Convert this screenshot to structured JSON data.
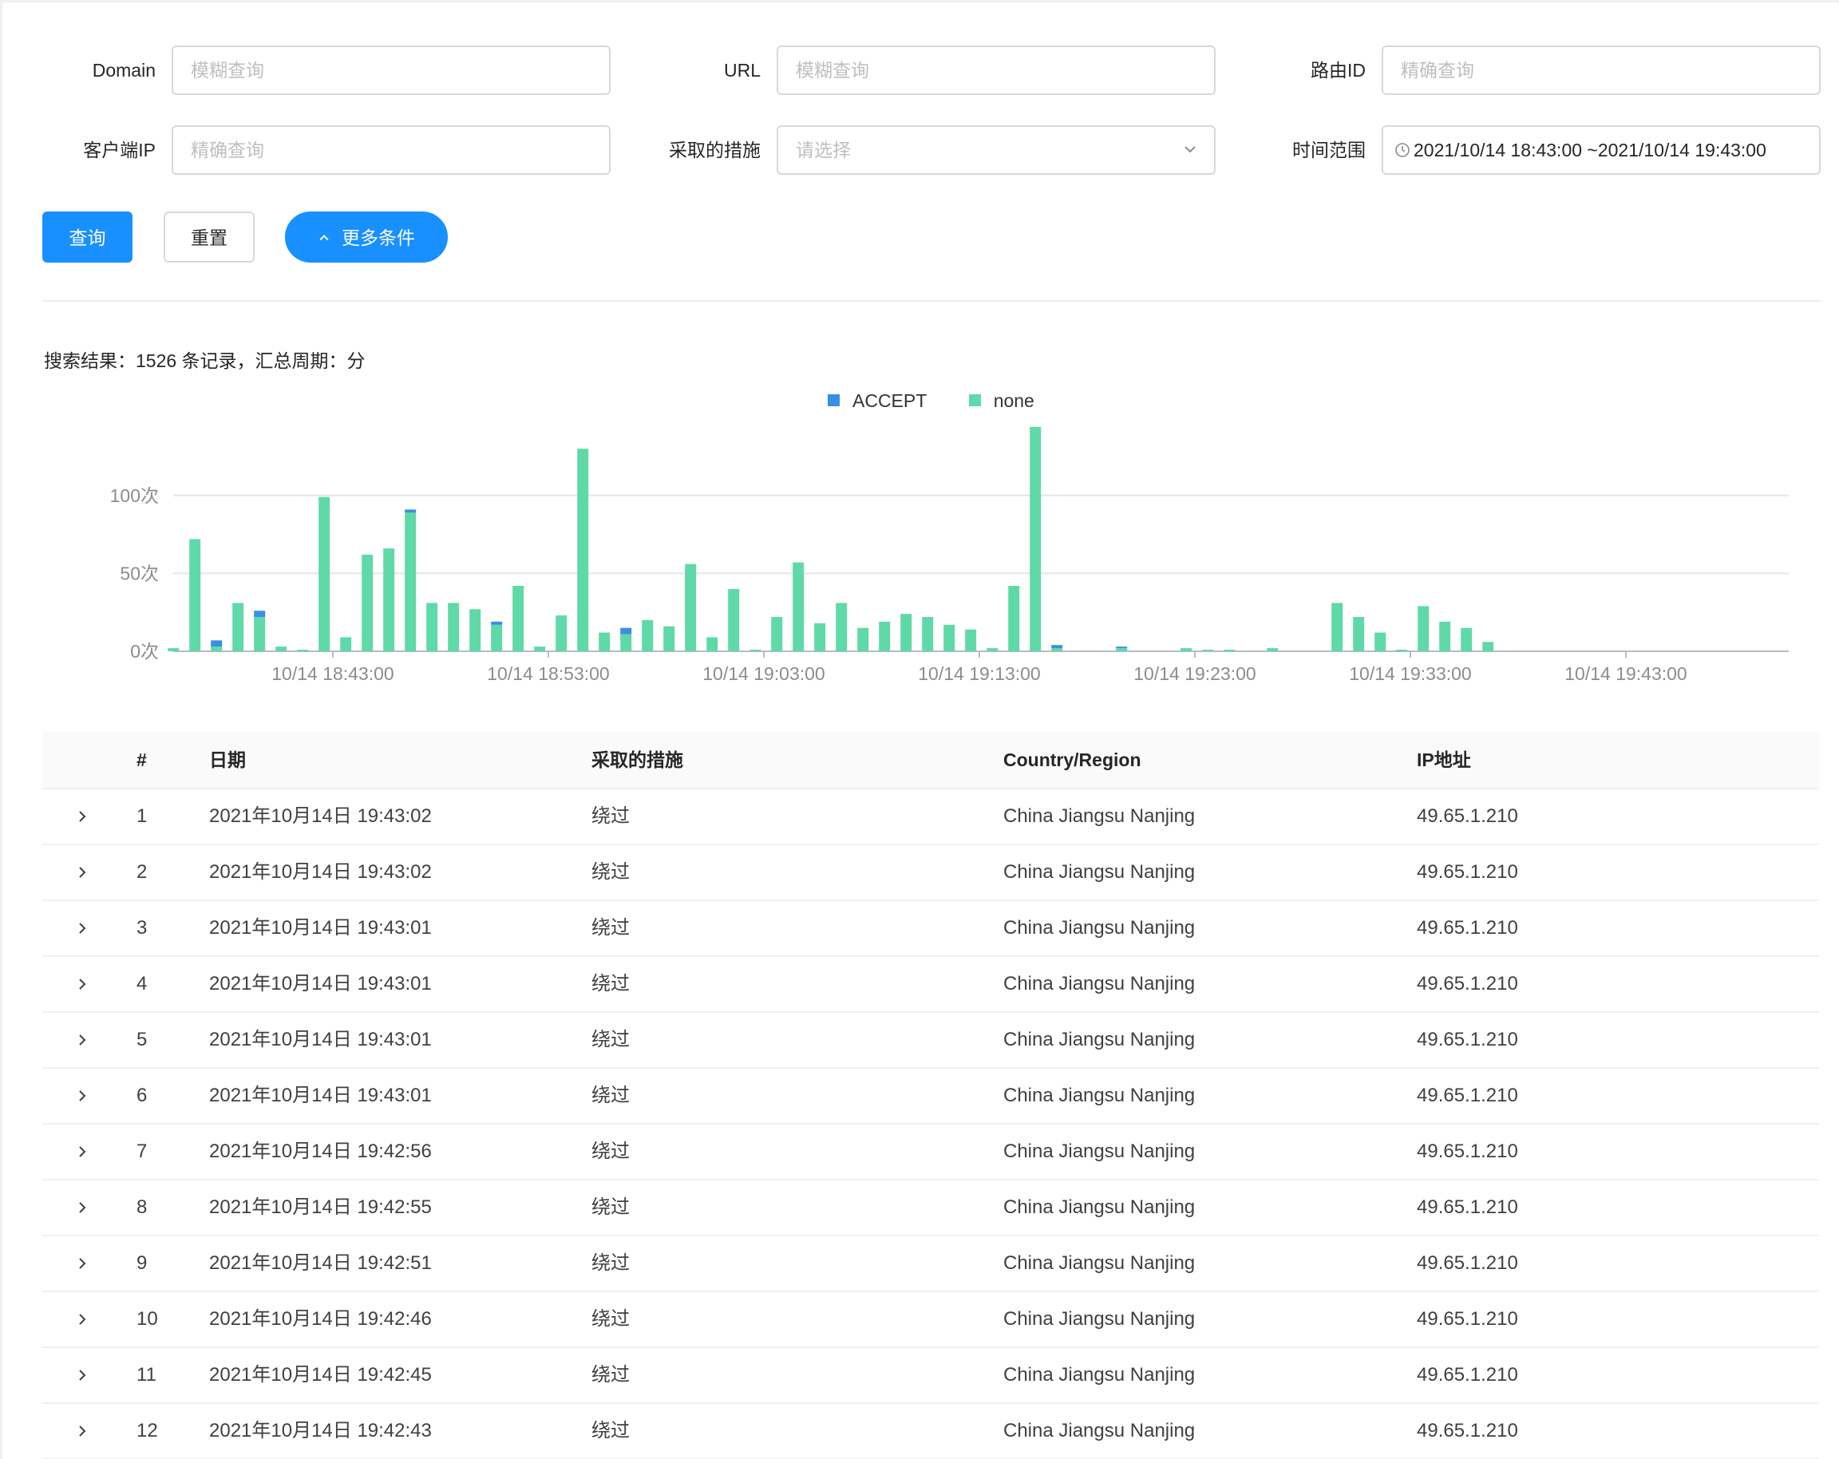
{
  "filters": {
    "domain_label": "Domain",
    "domain_placeholder": "模糊查询",
    "url_label": "URL",
    "url_placeholder": "模糊查询",
    "route_label": "路由ID",
    "route_placeholder": "精确查询",
    "client_ip_label": "客户端IP",
    "client_ip_placeholder": "精确查询",
    "action_label": "采取的措施",
    "action_placeholder": "请选择",
    "time_label": "时间范围",
    "time_value": "2021/10/14 18:43:00 ~2021/10/14 19:43:00"
  },
  "buttons": {
    "search": "查询",
    "reset": "重置",
    "more": "更多条件"
  },
  "summary": "搜索结果：1526 条记录，汇总周期：分",
  "chart_data": {
    "type": "bar",
    "stacked": true,
    "legend": [
      "ACCEPT",
      "none"
    ],
    "legend_position": "top-center",
    "grid": true,
    "y_tick_labels": [
      "0次",
      "50次",
      "100次"
    ],
    "ylim": [
      0,
      150
    ],
    "x_tick_labels": [
      "10/14 18:43:00",
      "10/14 18:53:00",
      "10/14 19:03:00",
      "10/14 19:13:00",
      "10/14 19:23:00",
      "10/14 19:33:00",
      "10/14 19:43:00"
    ],
    "x_minutes": [
      0,
      1,
      2,
      3,
      4,
      5,
      6,
      7,
      8,
      9,
      10,
      11,
      12,
      13,
      14,
      15,
      16,
      17,
      18,
      19,
      20,
      21,
      22,
      23,
      24,
      25,
      26,
      27,
      28,
      29,
      30,
      31,
      32,
      33,
      34,
      35,
      36,
      37,
      38,
      39,
      40,
      41,
      42,
      43,
      44,
      45,
      46,
      47,
      48,
      49,
      50,
      51,
      52,
      53,
      54,
      55,
      56,
      57,
      58,
      59,
      60
    ],
    "series": [
      {
        "name": "ACCEPT",
        "color": "#3a8ee6",
        "values": [
          0,
          0,
          4,
          0,
          4,
          0,
          0,
          0,
          0,
          0,
          0,
          2,
          0,
          0,
          0,
          2,
          0,
          0,
          0,
          0,
          0,
          4,
          0,
          0,
          0,
          0,
          0,
          0,
          0,
          0,
          0,
          0,
          0,
          0,
          0,
          0,
          0,
          0,
          0,
          0,
          0,
          2,
          0,
          0,
          1,
          0,
          0,
          0,
          0,
          0,
          0,
          0,
          0,
          0,
          0,
          0,
          0,
          0,
          0,
          0,
          0
        ]
      },
      {
        "name": "none",
        "color": "#5fd9a8",
        "values": [
          2,
          72,
          3,
          31,
          22,
          3,
          1,
          99,
          9,
          62,
          66,
          89,
          31,
          31,
          27,
          17,
          42,
          3,
          23,
          130,
          12,
          11,
          20,
          16,
          56,
          9,
          40,
          1,
          22,
          57,
          18,
          31,
          15,
          19,
          24,
          22,
          17,
          14,
          2,
          42,
          144,
          2,
          0,
          0,
          2,
          0,
          0,
          2,
          1,
          1,
          0,
          2,
          0,
          0,
          31,
          22,
          12,
          1,
          29,
          19,
          15,
          6
        ]
      }
    ]
  },
  "table": {
    "headers": [
      "#",
      "日期",
      "采取的措施",
      "Country/Region",
      "IP地址"
    ],
    "rows": [
      {
        "no": "1",
        "date": "2021年10月14日 19:43:02",
        "action": "绕过",
        "region": "China Jiangsu Nanjing",
        "ip": "49.65.1.210"
      },
      {
        "no": "2",
        "date": "2021年10月14日 19:43:02",
        "action": "绕过",
        "region": "China Jiangsu Nanjing",
        "ip": "49.65.1.210"
      },
      {
        "no": "3",
        "date": "2021年10月14日 19:43:01",
        "action": "绕过",
        "region": "China Jiangsu Nanjing",
        "ip": "49.65.1.210"
      },
      {
        "no": "4",
        "date": "2021年10月14日 19:43:01",
        "action": "绕过",
        "region": "China Jiangsu Nanjing",
        "ip": "49.65.1.210"
      },
      {
        "no": "5",
        "date": "2021年10月14日 19:43:01",
        "action": "绕过",
        "region": "China Jiangsu Nanjing",
        "ip": "49.65.1.210"
      },
      {
        "no": "6",
        "date": "2021年10月14日 19:43:01",
        "action": "绕过",
        "region": "China Jiangsu Nanjing",
        "ip": "49.65.1.210"
      },
      {
        "no": "7",
        "date": "2021年10月14日 19:42:56",
        "action": "绕过",
        "region": "China Jiangsu Nanjing",
        "ip": "49.65.1.210"
      },
      {
        "no": "8",
        "date": "2021年10月14日 19:42:55",
        "action": "绕过",
        "region": "China Jiangsu Nanjing",
        "ip": "49.65.1.210"
      },
      {
        "no": "9",
        "date": "2021年10月14日 19:42:51",
        "action": "绕过",
        "region": "China Jiangsu Nanjing",
        "ip": "49.65.1.210"
      },
      {
        "no": "10",
        "date": "2021年10月14日 19:42:46",
        "action": "绕过",
        "region": "China Jiangsu Nanjing",
        "ip": "49.65.1.210"
      },
      {
        "no": "11",
        "date": "2021年10月14日 19:42:45",
        "action": "绕过",
        "region": "China Jiangsu Nanjing",
        "ip": "49.65.1.210"
      },
      {
        "no": "12",
        "date": "2021年10月14日 19:42:43",
        "action": "绕过",
        "region": "China Jiangsu Nanjing",
        "ip": "49.65.1.210"
      }
    ]
  },
  "icons": {
    "select_arrow": "chevron-down-icon",
    "time_picker": "clock-icon",
    "more_toggle": "chevron-up-icon",
    "row_expand": "chevron-right-icon"
  }
}
